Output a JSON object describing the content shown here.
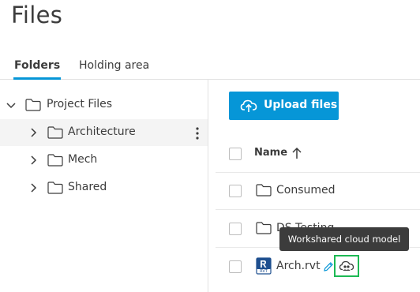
{
  "page": {
    "title": "Files"
  },
  "tabs": [
    {
      "label": "Folders",
      "active": true
    },
    {
      "label": "Holding area",
      "active": false
    }
  ],
  "tree": {
    "root": {
      "label": "Project Files",
      "expanded": true
    },
    "children": [
      {
        "label": "Architecture",
        "selected": true
      },
      {
        "label": "Mech",
        "selected": false
      },
      {
        "label": "Shared",
        "selected": false
      }
    ]
  },
  "toolbar": {
    "upload_label": "Upload files"
  },
  "list": {
    "header": {
      "name_label": "Name",
      "sort": "ascending"
    },
    "rows": [
      {
        "type": "folder",
        "label": "Consumed"
      },
      {
        "type": "folder",
        "label": "DS Testing"
      },
      {
        "type": "file",
        "label": "Arch.rvt",
        "file_badge": "RVT"
      }
    ]
  },
  "tooltip": {
    "text": "Workshared cloud model"
  },
  "colors": {
    "accent": "#0696d7",
    "highlight": "#1db954",
    "tooltip_bg": "#3c3c3c"
  }
}
